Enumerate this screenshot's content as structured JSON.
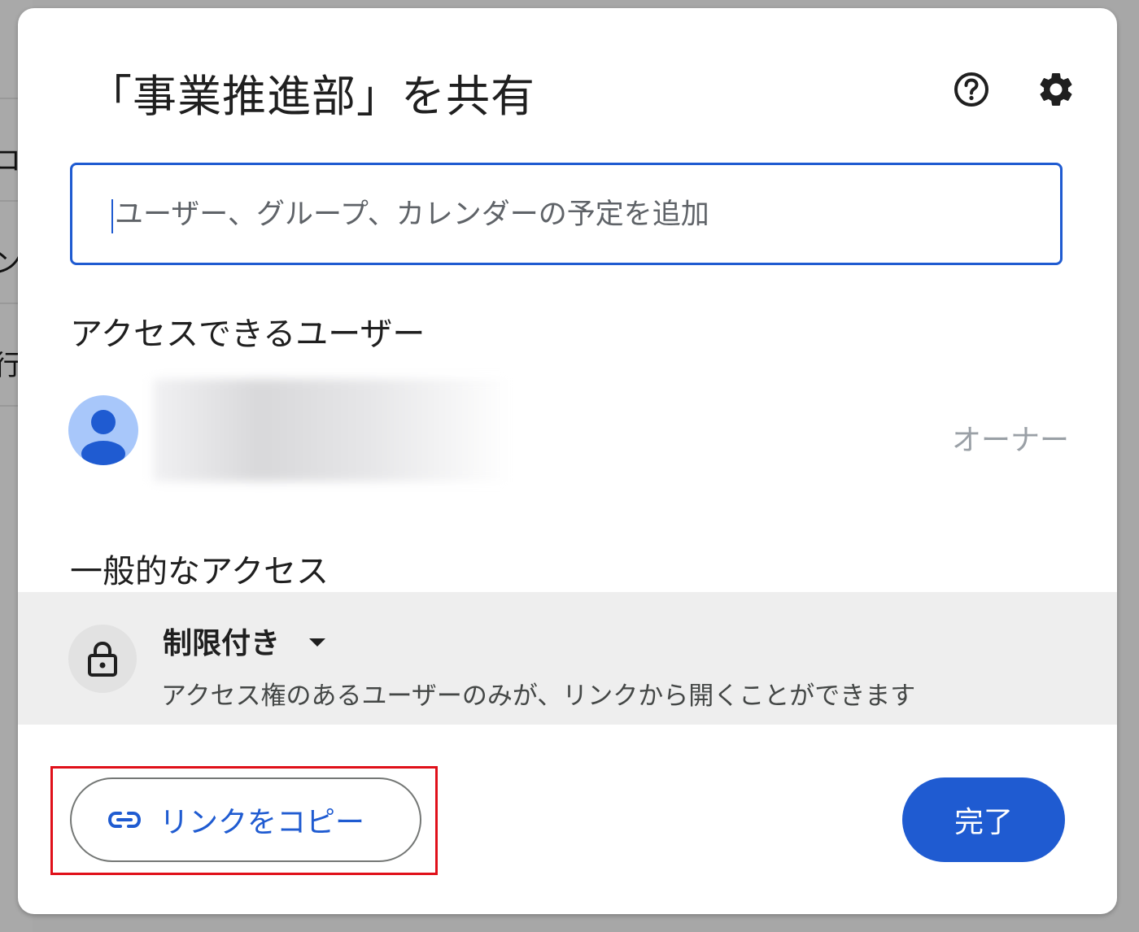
{
  "background": {
    "row_glyphs": [
      "コ",
      "ン",
      "行"
    ]
  },
  "dialog": {
    "title": "「事業推進部」を共有",
    "help_icon": "help-circle-icon",
    "settings_icon": "gear-icon",
    "share_input": {
      "value": "",
      "placeholder": "ユーザー、グループ、カレンダーの予定を追加"
    },
    "users_section": {
      "heading": "アクセスできるユーザー",
      "owner_role": "オーナー"
    },
    "general_access": {
      "heading": "一般的なアクセス",
      "level": "制限付き",
      "description": "アクセス権のあるユーザーのみが、リンクから開くことができます"
    },
    "footer": {
      "copy_link_label": "リンクをコピー",
      "done_label": "完了"
    }
  },
  "colors": {
    "accent": "#1f5bd1",
    "highlight": "#e0101a",
    "avatar_bg": "#a8c7fa",
    "avatar_fg": "#1f5bd1"
  }
}
